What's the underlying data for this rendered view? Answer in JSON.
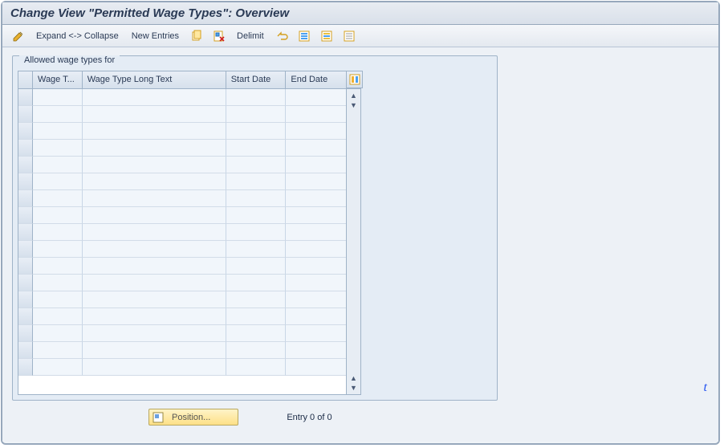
{
  "header": {
    "title": "Change View \"Permitted Wage Types\": Overview"
  },
  "toolbar": {
    "expand_collapse": "Expand <-> Collapse",
    "new_entries": "New Entries",
    "delimit": "Delimit"
  },
  "panel": {
    "title": "Allowed wage types for"
  },
  "table": {
    "columns": {
      "wage_type": "Wage T...",
      "long_text": "Wage Type Long Text",
      "start_date": "Start Date",
      "end_date": "End Date"
    },
    "row_count": 17
  },
  "footer": {
    "position_label": "Position...",
    "entry_status": "Entry 0 of 0"
  },
  "stray_char": "t"
}
